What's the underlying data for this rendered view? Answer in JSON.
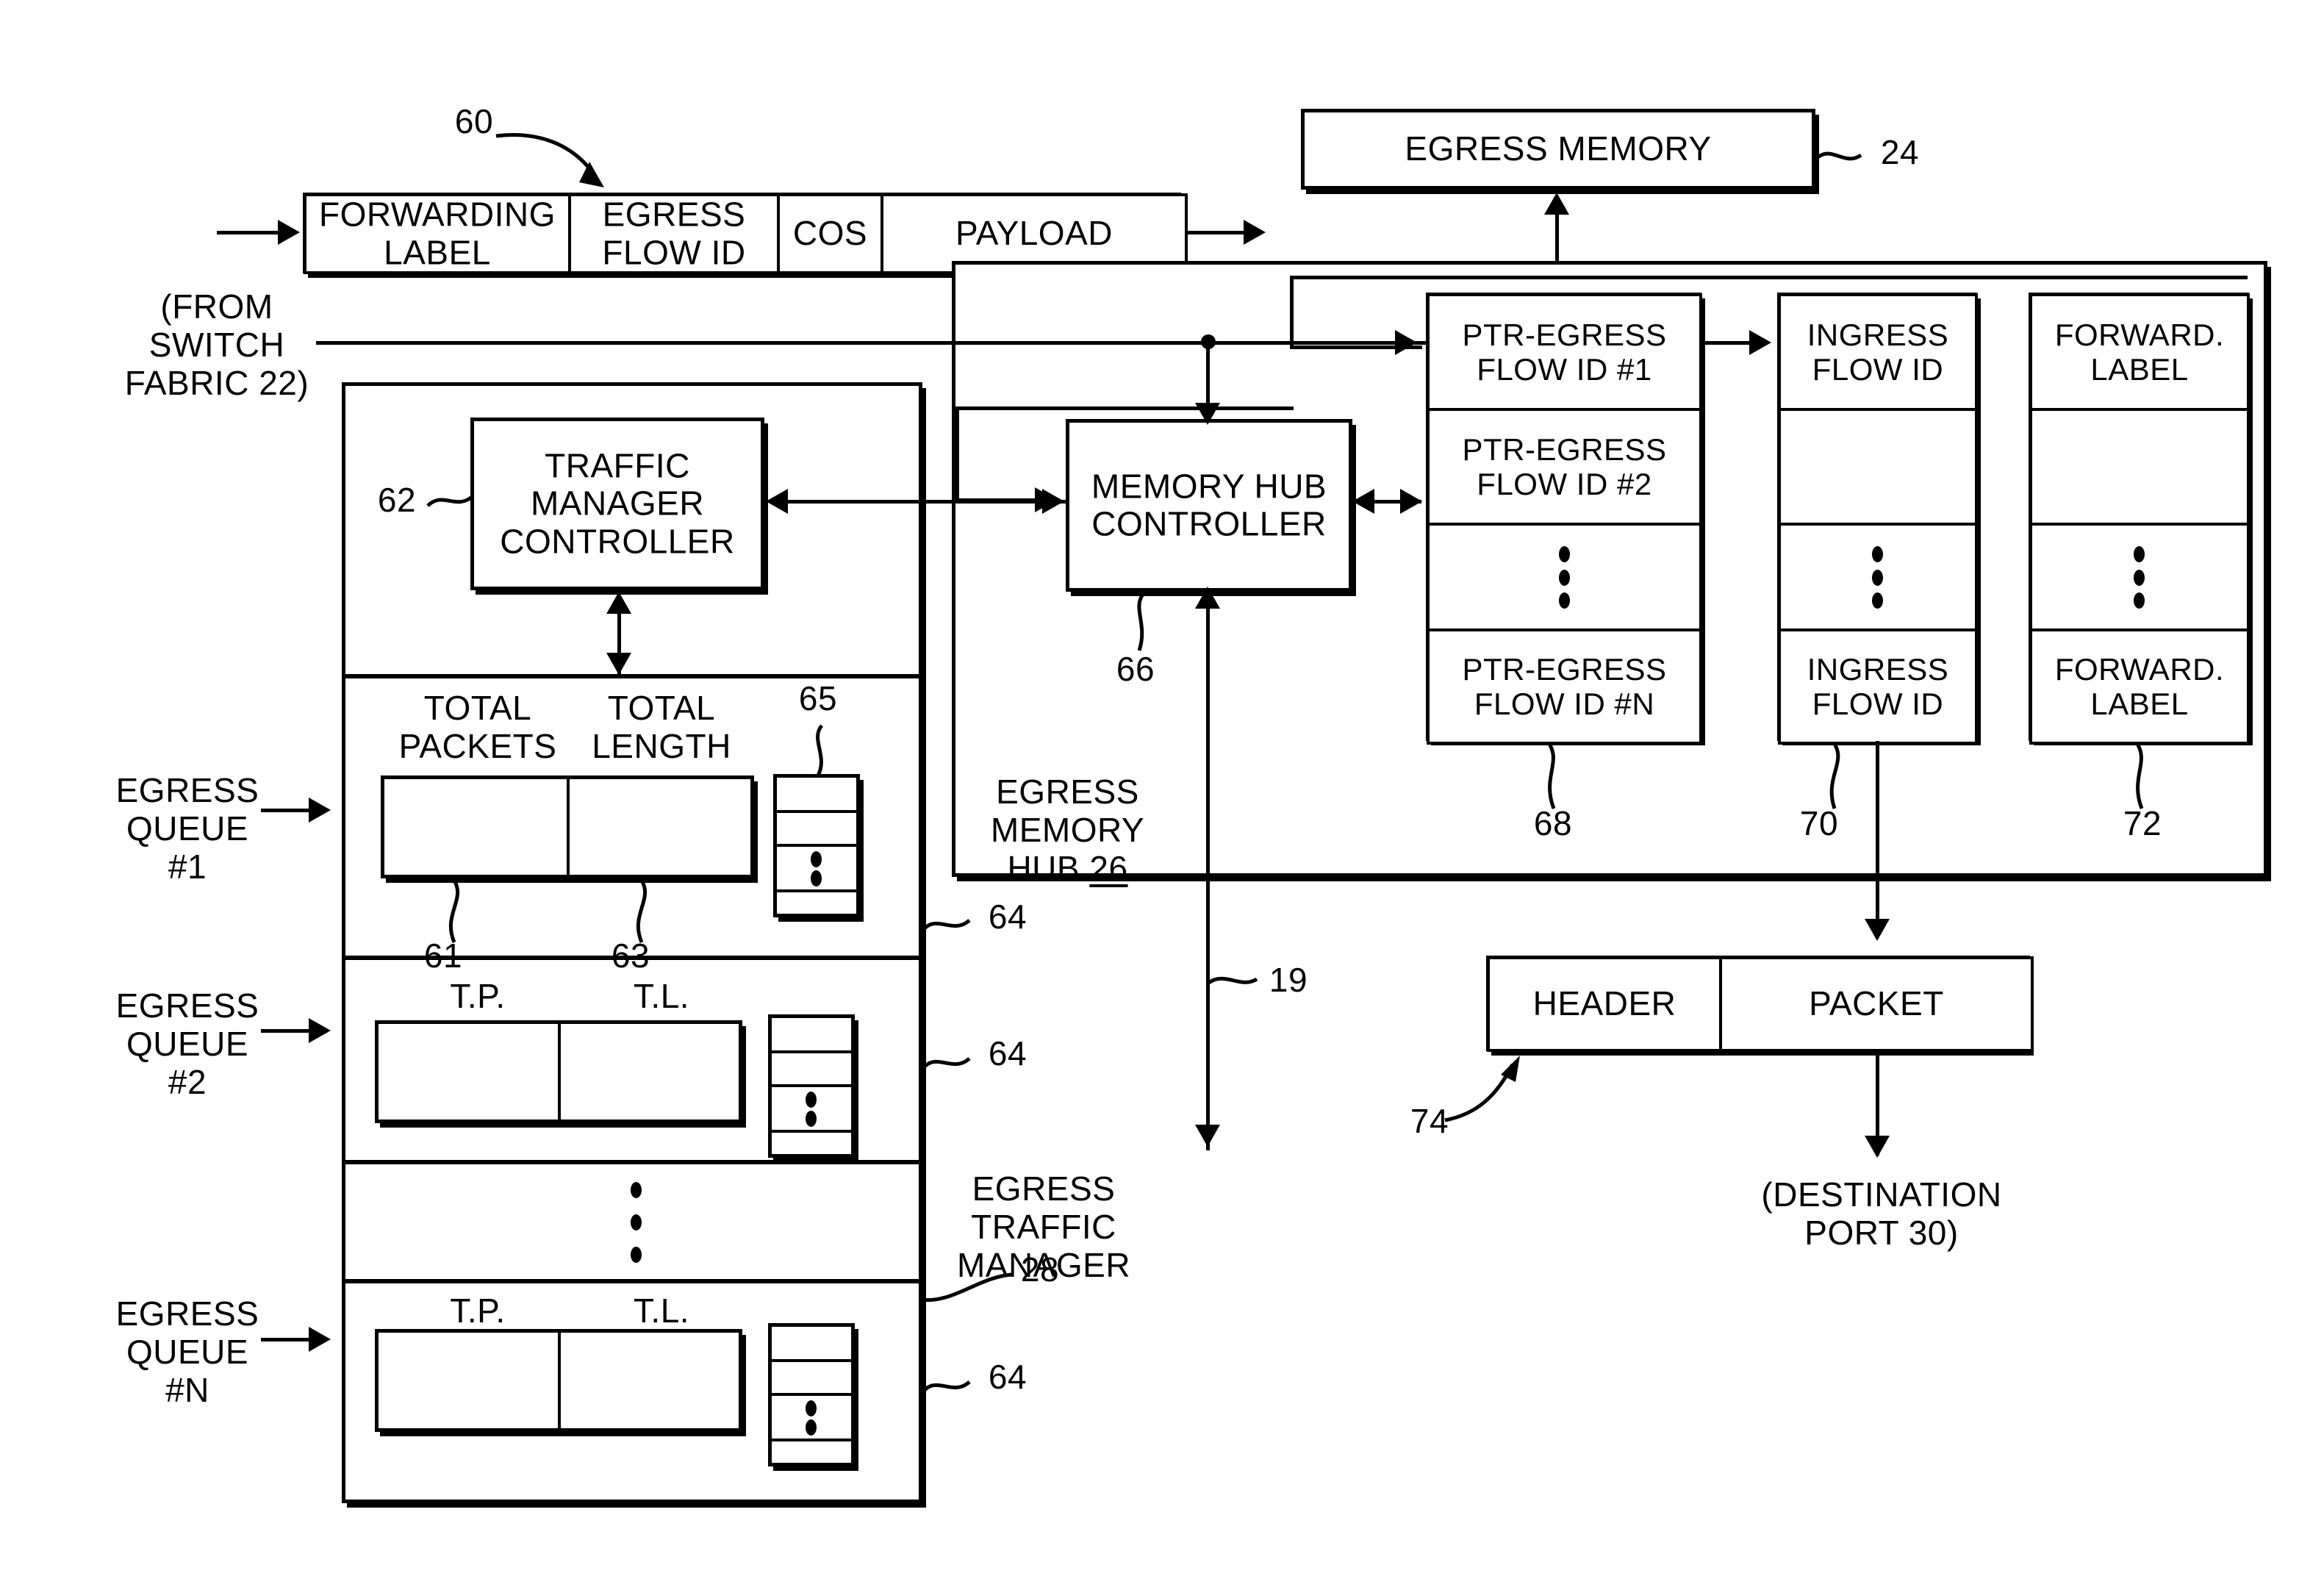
{
  "figure": {
    "ref_60": "60",
    "ref_24": "24",
    "ref_62": "62",
    "ref_65": "65",
    "ref_61": "61",
    "ref_63": "63",
    "ref_64_a": "64",
    "ref_64_b": "64",
    "ref_64_c": "64",
    "ref_66": "66",
    "ref_68": "68",
    "ref_70": "70",
    "ref_72": "72",
    "ref_74": "74",
    "ref_19": "19",
    "ref_28": "28"
  },
  "packet_format": {
    "fields": [
      {
        "label": "FORWARDING\nLABEL"
      },
      {
        "label": "EGRESS\nFLOW ID"
      },
      {
        "label": "COS"
      },
      {
        "label": "PAYLOAD"
      }
    ]
  },
  "inputs": {
    "from_switch_fabric": "(FROM\nSWITCH\nFABRIC 22)"
  },
  "egress_memory": {
    "title": "EGRESS MEMORY"
  },
  "egress_memory_hub": {
    "title": "EGRESS\nMEMORY\nHUB ",
    "title_ref": "26",
    "controller": "MEMORY\nHUB\nCONTROLLER",
    "columns": [
      {
        "name": "ptr-egress-flow-id",
        "cells": [
          "PTR-EGRESS\nFLOW ID #1",
          "PTR-EGRESS\nFLOW ID #2",
          "⋮",
          "PTR-EGRESS\nFLOW ID #N"
        ]
      },
      {
        "name": "ingress-flow-id",
        "cells": [
          "INGRESS\nFLOW ID",
          "",
          "⋮",
          "INGRESS\nFLOW ID"
        ]
      },
      {
        "name": "forward-label",
        "cells": [
          "FORWARD.\nLABEL",
          "",
          "⋮",
          "FORWARD.\nLABEL"
        ]
      }
    ]
  },
  "egress_traffic_manager": {
    "title": "EGRESS\nTRAFFIC\nMANAGER",
    "controller": "TRAFFIC\nMANAGER\nCONTROLLER",
    "queues": [
      {
        "label": "EGRESS\nQUEUE\n#1",
        "col1": "TOTAL\nPACKETS",
        "col2": "TOTAL\nLENGTH"
      },
      {
        "label": "EGRESS\nQUEUE\n#2",
        "col1": "T.P.",
        "col2": "T.L."
      },
      {
        "label": "EGRESS\nQUEUE\n#N",
        "col1": "T.P.",
        "col2": "T.L."
      }
    ]
  },
  "output_packet": {
    "fields": [
      {
        "label": "HEADER"
      },
      {
        "label": "PACKET"
      }
    ],
    "destination": "(DESTINATION\nPORT 30)"
  }
}
